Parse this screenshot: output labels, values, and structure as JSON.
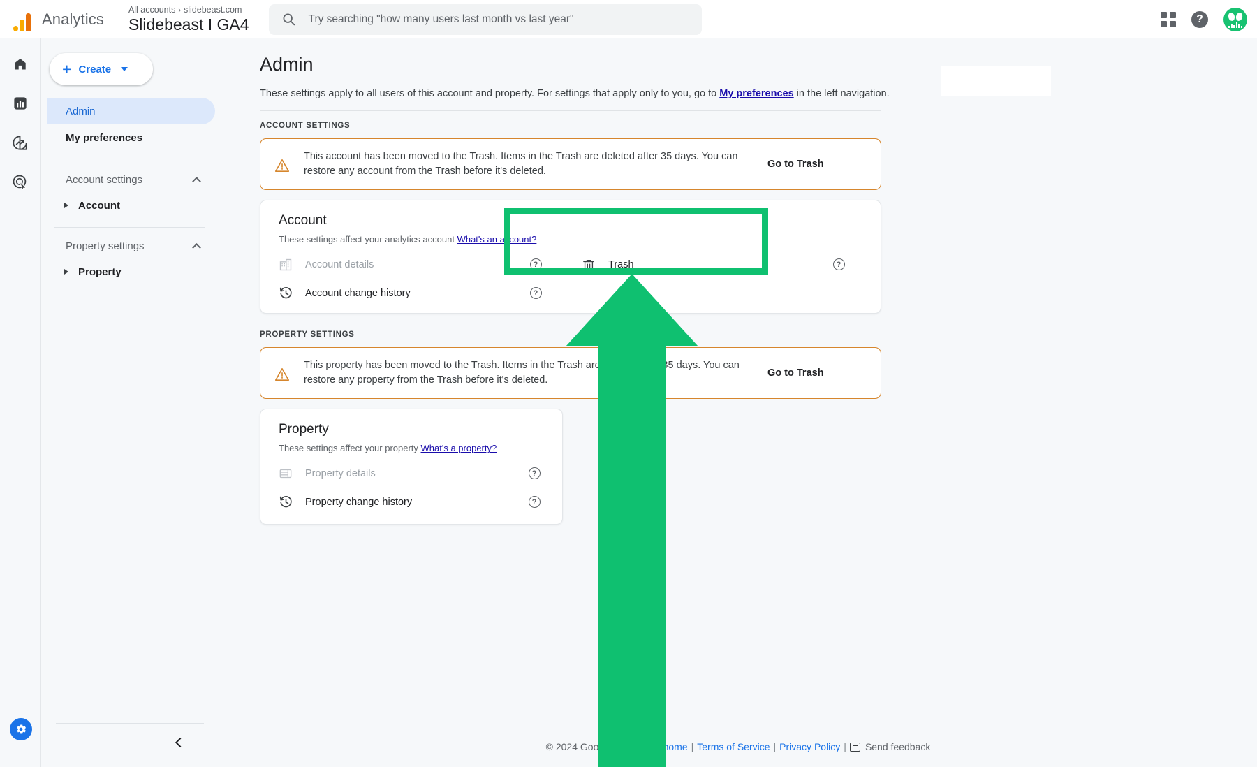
{
  "topbar": {
    "logo_icon": "analytics-logo-icon",
    "brand": "Analytics",
    "breadcrumb_root": "All accounts",
    "breadcrumb_sep": "›",
    "breadcrumb_current": "slidebeast.com",
    "property_title": "Slidebeast  I GA4",
    "search": {
      "icon": "search-icon",
      "placeholder": "Try searching \"how many users last month vs last year\"",
      "value": ""
    },
    "apps_icon": "apps-grid-icon",
    "help_icon": "help-icon",
    "help_glyph": "?",
    "avatar_icon": "user-avatar-icon"
  },
  "rail": {
    "items": [
      {
        "icon": "home-icon",
        "name": "home"
      },
      {
        "icon": "reports-bar-chart-icon",
        "name": "reports"
      },
      {
        "icon": "explore-trend-icon",
        "name": "explore"
      },
      {
        "icon": "advertising-cursor-icon",
        "name": "advertising"
      }
    ],
    "gear_icon": "gear-icon"
  },
  "nav": {
    "create_button": {
      "label": "Create",
      "plus_icon": "plus-icon",
      "caret_icon": "chevron-down-icon"
    },
    "items": [
      {
        "label": "Admin",
        "active": true
      },
      {
        "label": "My preferences",
        "active": false
      }
    ],
    "groups": [
      {
        "label": "Account settings",
        "chevron_icon": "chevron-up-icon",
        "children": [
          {
            "label": "Account",
            "expander_icon": "triangle-right-icon"
          }
        ]
      },
      {
        "label": "Property settings",
        "chevron_icon": "chevron-up-icon",
        "children": [
          {
            "label": "Property",
            "expander_icon": "triangle-right-icon"
          }
        ]
      }
    ],
    "collapse_icon": "chevron-left-icon"
  },
  "main": {
    "title": "Admin",
    "description_before": "These settings apply to all users of this account and property. For settings that apply only to you, go to ",
    "description_link": "My preferences",
    "description_after": " in the left navigation.",
    "account_section_label": "ACCOUNT SETTINGS",
    "property_section_label": "PROPERTY SETTINGS",
    "account_warning": {
      "icon": "warning-triangle-icon",
      "text": "This account has been moved to the Trash. Items in the Trash are deleted after 35 days. You can restore any account from the Trash before it's deleted.",
      "action": "Go to Trash"
    },
    "property_warning": {
      "icon": "warning-triangle-icon",
      "text": "This property has been moved to the Trash. Items in the Trash are deleted after 35 days. You can restore any property from the Trash before it's deleted.",
      "action": "Go to Trash"
    },
    "account_card": {
      "title": "Account",
      "sub_text": "These settings affect your analytics account ",
      "sub_link": "What's an account?",
      "left_rows": [
        {
          "icon": "building-icon",
          "label": "Account details",
          "disabled": true,
          "help_icon": "help-circle-icon"
        },
        {
          "icon": "history-clock-icon",
          "label": "Account change history",
          "disabled": false,
          "help_icon": "help-circle-icon"
        }
      ],
      "right_rows": [
        {
          "icon": "trash-icon",
          "label": "Trash",
          "disabled": false,
          "help_icon": "help-circle-icon"
        }
      ]
    },
    "property_card": {
      "title": "Property",
      "sub_text": "These settings affect your property ",
      "sub_link": "What's a property?",
      "rows": [
        {
          "icon": "property-details-icon",
          "label": "Property details",
          "disabled": true,
          "help_icon": "help-circle-icon"
        },
        {
          "icon": "history-clock-icon",
          "label": "Property change history",
          "disabled": false,
          "help_icon": "help-circle-icon"
        }
      ]
    }
  },
  "footer": {
    "copyright": "© 2024 Google",
    "links": [
      "Analytics home",
      "Terms of Service",
      "Privacy Policy"
    ],
    "feedback_icon": "feedback-icon",
    "feedback": "Send feedback",
    "pipe": "|"
  },
  "annotation": {
    "highlight_color": "#0fc070",
    "arrow_icon": "up-arrow-annotation",
    "target": "Trash"
  }
}
